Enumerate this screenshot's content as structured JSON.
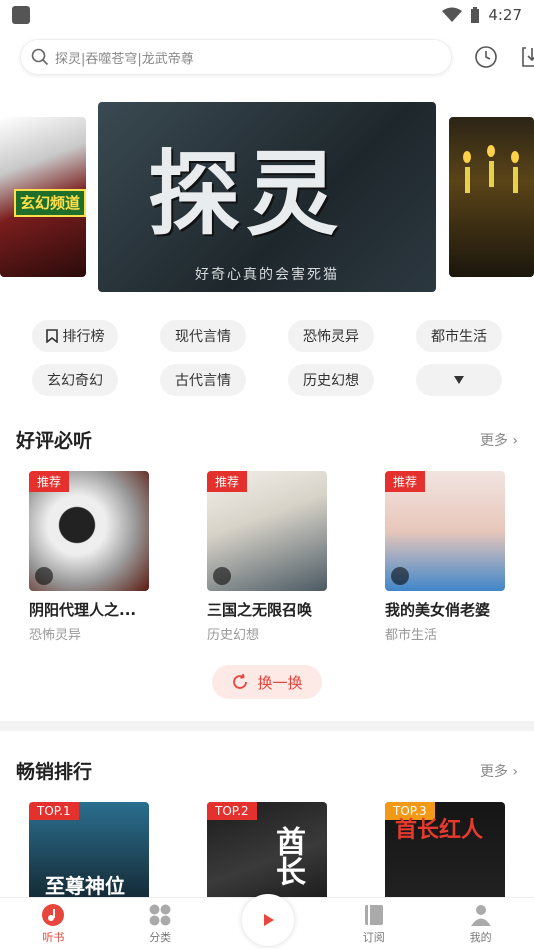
{
  "status": {
    "time": "4:27"
  },
  "search": {
    "placeholder": "探灵|吞噬苍穹|龙武帝尊"
  },
  "banner": {
    "main_title": "探灵",
    "main_subtitle": "好奇心真的会害死猫",
    "left_tag": "玄幻频道"
  },
  "categories": [
    "排行榜",
    "现代言情",
    "恐怖灵异",
    "都市生活",
    "玄幻奇幻",
    "古代言情",
    "历史幻想"
  ],
  "section1": {
    "title": "好评必听",
    "more": "更多",
    "books": [
      {
        "badge": "推荐",
        "title": "阴阳代理人之...",
        "category": "恐怖灵异"
      },
      {
        "badge": "推荐",
        "title": "三国之无限召唤",
        "category": "历史幻想"
      },
      {
        "badge": "推荐",
        "title": "我的美女俏老婆",
        "category": "都市生活"
      }
    ],
    "refresh": "换一换"
  },
  "section2": {
    "title": "畅销排行",
    "more": "更多",
    "books": [
      {
        "badge": "TOP.1",
        "cover_text": "至尊神位"
      },
      {
        "badge": "TOP.2",
        "cover_text": "酋长"
      },
      {
        "badge": "TOP.3",
        "cover_text": "首长红人"
      }
    ]
  },
  "tabs": [
    "听书",
    "分类",
    "订阅",
    "我的"
  ],
  "colors": {
    "accent": "#e8453c"
  }
}
